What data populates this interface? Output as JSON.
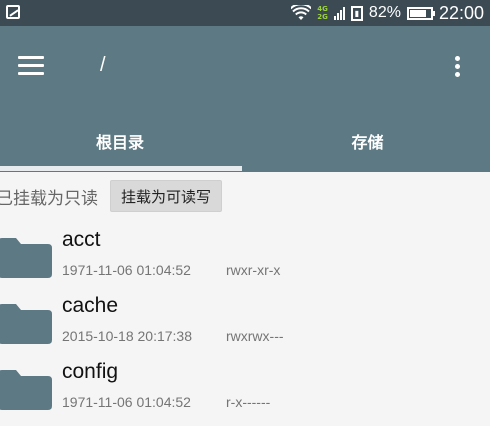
{
  "status_bar": {
    "net_top": "4G",
    "net_bottom": "2G",
    "sim_icon": "sim-card-icon",
    "battery_percent": "82%",
    "battery_level": 0.82,
    "time": "22:00"
  },
  "app_bar": {
    "menu_icon": "hamburger-menu-icon",
    "title": "/",
    "more_icon": "more-vert-icon",
    "background": "#5d7a84"
  },
  "tabs": [
    {
      "label": "根目录",
      "active": true
    },
    {
      "label": "存储",
      "active": false
    }
  ],
  "mount": {
    "status": "已挂载为只读",
    "button_label": "挂载为可读写"
  },
  "files": [
    {
      "name": "acct",
      "date": "1971-11-06 01:04:52",
      "perms": "rwxr-xr-x",
      "icon": "folder-icon"
    },
    {
      "name": "cache",
      "date": "2015-10-18 20:17:38",
      "perms": "rwxrwx---",
      "icon": "folder-icon"
    },
    {
      "name": "config",
      "date": "1971-11-06 01:04:52",
      "perms": "r-x------",
      "icon": "folder-icon"
    }
  ]
}
